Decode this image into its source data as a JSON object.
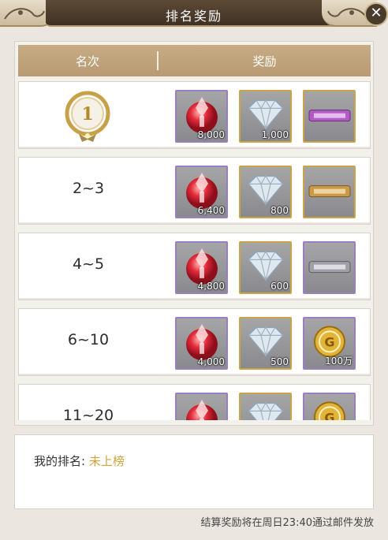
{
  "dialog": {
    "title": "排名奖励",
    "close_icon": "close-icon"
  },
  "table": {
    "header_rank": "名次",
    "header_reward": "奖励",
    "rows": [
      {
        "rank": "1",
        "rank_display": "medal",
        "rewards": [
          {
            "icon": "red-gem-icon",
            "qty": "8,000",
            "frame": "purple"
          },
          {
            "icon": "diamond-icon",
            "qty": "1,000",
            "frame": "gold"
          },
          {
            "icon": "purple-title-banner-icon",
            "qty": "",
            "frame": "gold"
          }
        ]
      },
      {
        "rank": "2~3",
        "rewards": [
          {
            "icon": "red-gem-icon",
            "qty": "6,400",
            "frame": "purple"
          },
          {
            "icon": "diamond-icon",
            "qty": "800",
            "frame": "gold"
          },
          {
            "icon": "gold-title-banner-icon",
            "qty": "",
            "frame": "gold"
          }
        ]
      },
      {
        "rank": "4~5",
        "rewards": [
          {
            "icon": "red-gem-icon",
            "qty": "4,800",
            "frame": "purple"
          },
          {
            "icon": "diamond-icon",
            "qty": "600",
            "frame": "gold"
          },
          {
            "icon": "silver-title-banner-icon",
            "qty": "",
            "frame": "purple"
          }
        ]
      },
      {
        "rank": "6~10",
        "rewards": [
          {
            "icon": "red-gem-icon",
            "qty": "4,000",
            "frame": "purple"
          },
          {
            "icon": "diamond-icon",
            "qty": "500",
            "frame": "gold"
          },
          {
            "icon": "gold-coin-icon",
            "qty": "100万",
            "frame": "purple"
          }
        ]
      },
      {
        "rank": "11~20",
        "rewards": [
          {
            "icon": "red-gem-icon",
            "qty": "",
            "frame": "purple"
          },
          {
            "icon": "diamond-icon",
            "qty": "",
            "frame": "gold"
          },
          {
            "icon": "gold-coin-icon",
            "qty": "",
            "frame": "purple"
          }
        ]
      }
    ]
  },
  "my_rank": {
    "label": "我的排名: ",
    "value": "未上榜"
  },
  "footer_note": "结算奖励将在周日23:40通过邮件发放",
  "colors": {
    "header": "#c7ab84",
    "accent_gold": "#cfa43a",
    "title_bar": "#4a3a2b"
  }
}
